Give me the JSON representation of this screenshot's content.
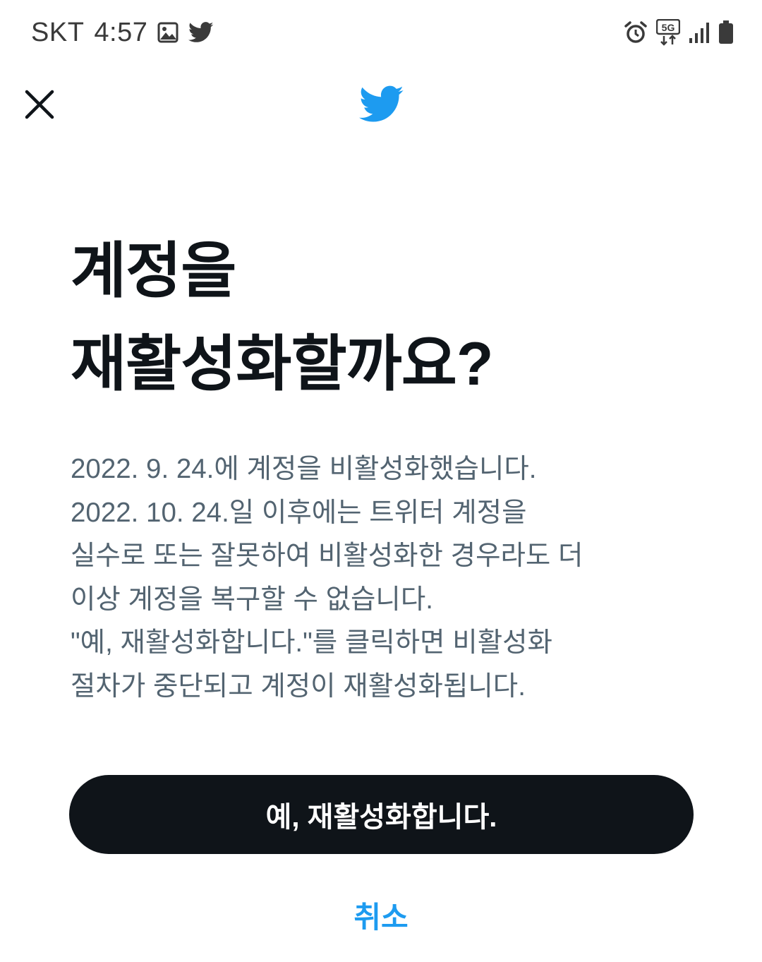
{
  "status_bar": {
    "carrier": "SKT",
    "time": "4:57",
    "left_icons": [
      "gallery-icon",
      "twitter-notification-icon"
    ],
    "right_icons": [
      "alarm-icon",
      "5g-data-icon",
      "signal-icon",
      "battery-icon"
    ],
    "network_label": "5G"
  },
  "nav": {
    "close_icon": "close-icon",
    "logo_icon": "twitter-bird-icon"
  },
  "dialog": {
    "title_lines": [
      "계정을",
      "재활성화할까요?"
    ],
    "body_lines": [
      "2022. 9. 24.에 계정을 비활성화했습니다.",
      "2022. 10. 24.일 이후에는 트위터 계정을",
      "실수로 또는 잘못하여 비활성화한 경우라도 더",
      "이상 계정을 복구할 수 없습니다.",
      "\"예, 재활성화합니다.\"를 클릭하면 비활성화",
      "절차가 중단되고 계정이 재활성화됩니다."
    ],
    "confirm_label": "예, 재활성화합니다.",
    "cancel_label": "취소"
  },
  "colors": {
    "brand_blue": "#1d9bf0",
    "primary_text": "#0f1419",
    "secondary_text": "#536471",
    "button_bg": "#0f1419",
    "background": "#ffffff"
  }
}
